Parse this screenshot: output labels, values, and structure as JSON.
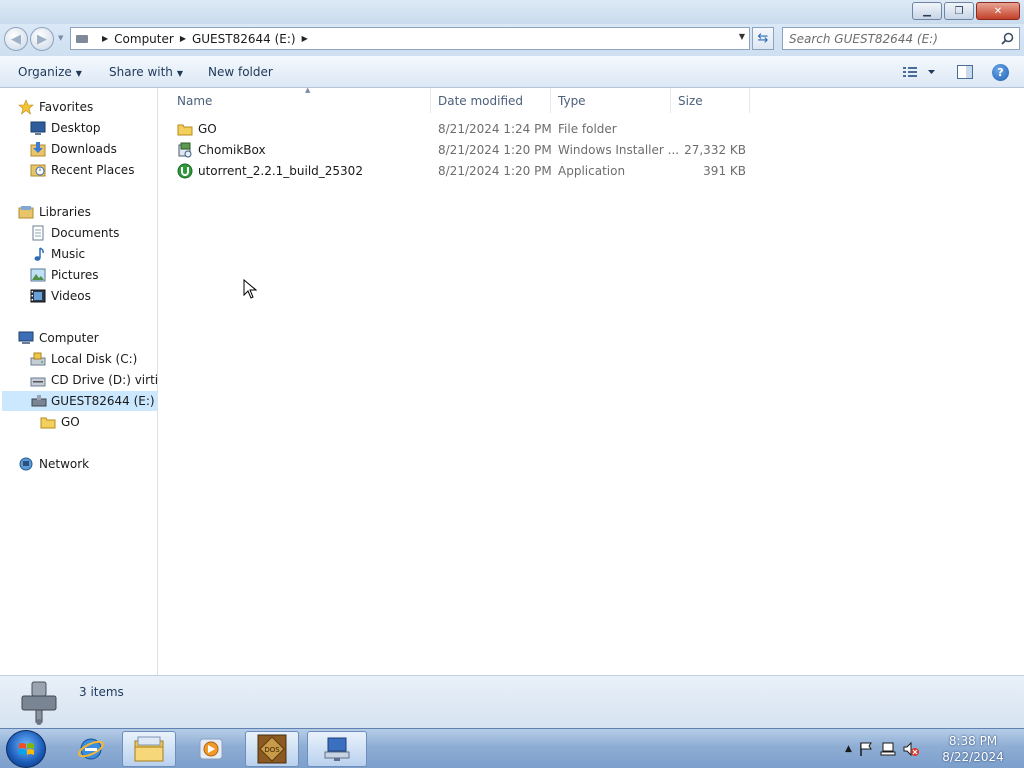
{
  "window": {
    "controls": {
      "minimize": "▁",
      "maximize": "❐",
      "close": "✕"
    }
  },
  "address": {
    "crumbs": [
      "Computer",
      "GUEST82644 (E:)"
    ],
    "search_placeholder": "Search GUEST82644 (E:)"
  },
  "toolbar": {
    "organize": "Organize",
    "share_with": "Share with",
    "new_folder": "New folder",
    "help": "?"
  },
  "nav": {
    "favorites": {
      "label": "Favorites",
      "items": [
        "Desktop",
        "Downloads",
        "Recent Places"
      ]
    },
    "libraries": {
      "label": "Libraries",
      "items": [
        "Documents",
        "Music",
        "Pictures",
        "Videos"
      ]
    },
    "computer": {
      "label": "Computer",
      "items": [
        "Local Disk (C:)",
        "CD Drive (D:) virtio-win",
        "GUEST82644 (E:)"
      ],
      "subitem": "GO"
    },
    "network": {
      "label": "Network"
    }
  },
  "columns": {
    "name": "Name",
    "date": "Date modified",
    "type": "Type",
    "size": "Size"
  },
  "files": [
    {
      "name": "GO",
      "date": "8/21/2024 1:24 PM",
      "type": "File folder",
      "size": "",
      "icon": "folder-icon"
    },
    {
      "name": "ChomikBox",
      "date": "8/21/2024 1:20 PM",
      "type": "Windows Installer ...",
      "size": "27,332 KB",
      "icon": "installer-icon"
    },
    {
      "name": "utorrent_2.2.1_build_25302",
      "date": "8/21/2024 1:20 PM",
      "type": "Application",
      "size": "391 KB",
      "icon": "utorrent-icon"
    }
  ],
  "status": {
    "item_count": "3 items"
  },
  "taskbar": {
    "apps": [
      "internet-explorer-icon",
      "explorer-icon",
      "media-player-icon",
      "dosbox-icon",
      "network-app-icon"
    ],
    "clock": {
      "time": "8:38 PM",
      "date": "8/22/2024"
    }
  },
  "colors": {
    "accent": "#1e395b",
    "selection": "#cce8ff",
    "taskbar": "#8eadd4"
  }
}
